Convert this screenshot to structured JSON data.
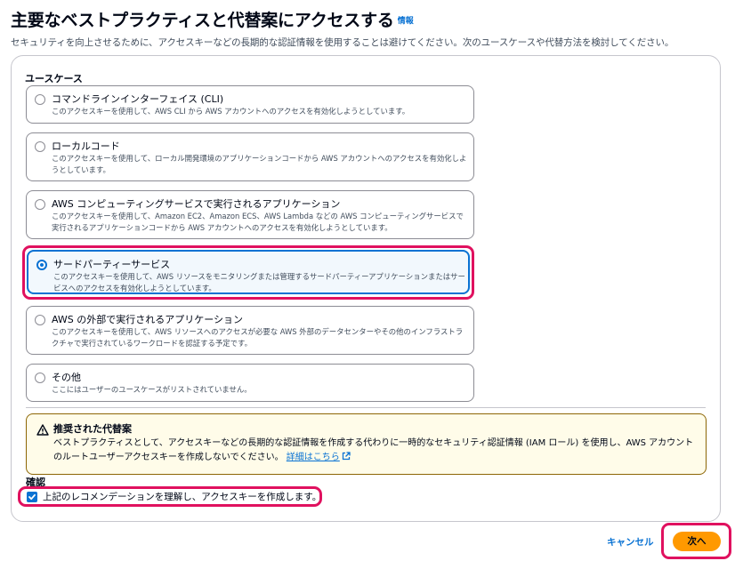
{
  "header": {
    "title": "主要なベストプラクティスと代替案にアクセスする",
    "info_link": "情報",
    "description": "セキュリティを向上させるために、アクセスキーなどの長期的な認証情報を使用することは避けてください。次のユースケースや代替方法を検討してください。"
  },
  "use_case": {
    "section_label": "ユースケース",
    "options": [
      {
        "label": "コマンドラインインターフェイス (CLI)",
        "description": "このアクセスキーを使用して、AWS CLI から AWS アカウントへのアクセスを有効化しようとしています。",
        "selected": false
      },
      {
        "label": "ローカルコード",
        "description": "このアクセスキーを使用して、ローカル開発環境のアプリケーションコードから AWS アカウントへのアクセスを有効化しようとしています。",
        "selected": false
      },
      {
        "label": "AWS コンピューティングサービスで実行されるアプリケーション",
        "description": "このアクセスキーを使用して、Amazon EC2、Amazon ECS、AWS Lambda などの AWS コンピューティングサービスで実行されるアプリケーションコードから AWS アカウントへのアクセスを有効化しようとしています。",
        "selected": false
      },
      {
        "label": "サードパーティーサービス",
        "description": "このアクセスキーを使用して、AWS リソースをモニタリングまたは管理するサードパーティーアプリケーションまたはサービスへのアクセスを有効化しようとしています。",
        "selected": true
      },
      {
        "label": "AWS の外部で実行されるアプリケーション",
        "description": "このアクセスキーを使用して、AWS リソースへのアクセスが必要な AWS 外部のデータセンターやその他のインフラストラクチャで実行されているワークロードを認証する予定です。",
        "selected": false
      },
      {
        "label": "その他",
        "description": "ここにはユーザーのユースケースがリストされていません。",
        "selected": false
      }
    ]
  },
  "alert": {
    "icon": "warning-icon",
    "title": "推奨された代替案",
    "body": "ベストプラクティスとして、アクセスキーなどの長期的な認証情報を作成する代わりに一時的なセキュリティ認証情報 (IAM ロール) を使用し、AWS アカウントのルートユーザーアクセスキーを作成しないでください。",
    "link_text": "詳細はこちら"
  },
  "confirmation": {
    "label": "確認",
    "checkbox_label": "上記のレコメンデーションを理解し、アクセスキーを作成します。",
    "checked": true
  },
  "footer": {
    "cancel_label": "キャンセル",
    "next_label": "次へ"
  },
  "colors": {
    "accent": "#0972d3",
    "primary_button": "#ff9900",
    "highlight": "#e0115f",
    "warning_border": "#8d6605",
    "warning_bg": "#fffce9"
  }
}
